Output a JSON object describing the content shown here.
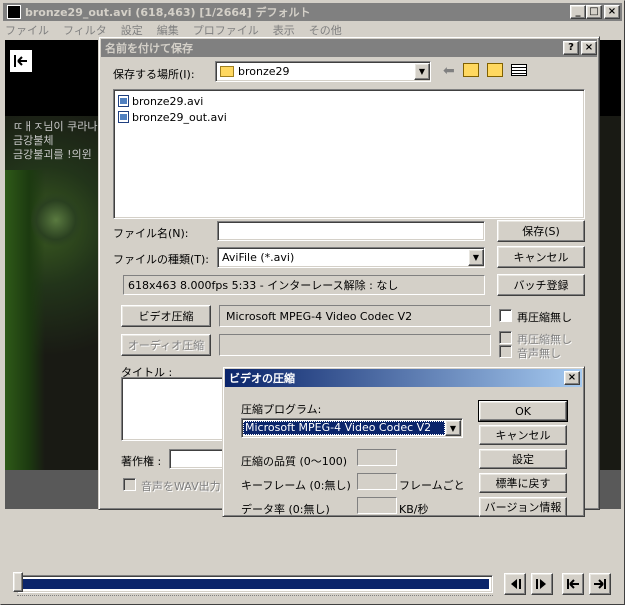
{
  "main": {
    "title": "bronze29_out.avi (618,463) [1/2664] デフォルト",
    "menu": [
      "ファイル",
      "フィルタ",
      "設定",
      "編集",
      "プロファイル",
      "表示",
      "その他"
    ],
    "video_text_lines": [
      "ㄸㅐㅈ님이 쿠라나",
      "금강불체",
      "금강불괴를 !의윈"
    ],
    "back_icon": "arrow-left-bar-icon",
    "transport": [
      "prev-frame-icon",
      "next-frame-icon",
      "first-frame-icon",
      "last-frame-icon"
    ],
    "progress_fraction": 0.0004
  },
  "save_dialog": {
    "title": "名前を付けて保存",
    "save_in_label": "保存する場所(I):",
    "save_in_value": "bronze29",
    "files": [
      "bronze29.avi",
      "bronze29_out.avi"
    ],
    "filename_label": "ファイル名(N):",
    "filename_value": "",
    "filetype_label": "ファイルの種類(T):",
    "filetype_value": "AviFile (*.avi)",
    "save_button": "保存(S)",
    "cancel_button": "キャンセル",
    "batch_button": "バッチ登録",
    "info_text": "618x463  8.000fps  5:33  -  インターレース解除 : なし",
    "video_compress_button": "ビデオ圧縮",
    "video_codec": "Microsoft MPEG-4 Video Codec V2",
    "no_recompress_label": "再圧縮無し",
    "audio_compress_button": "オーディオ圧縮",
    "audio_no_recompress_label": "再圧縮無し",
    "no_audio_label": "音声無し",
    "title_label": "タイトル :",
    "copyright_label": "著作権 :",
    "wav_output_label": "音声をWAV出力"
  },
  "codec_dialog": {
    "title": "ビデオの圧縮",
    "program_label": "圧縮プログラム:",
    "program_value": "Microsoft MPEG-4 Video Codec V2",
    "quality_label": "圧縮の品質 (0〜100)",
    "keyframe_label": "キーフレーム (0:無し)",
    "keyframe_unit": "フレームごと",
    "datarate_label": "データ率 (0:無し)",
    "datarate_unit": "KB/秒",
    "ok_button": "OK",
    "cancel_button": "キャンセル",
    "settings_button": "設定",
    "default_button": "標準に戻す",
    "version_button": "バージョン情報"
  },
  "colors": {
    "active_caption": "#0a246a",
    "inactive_caption": "#808080",
    "progress": "#0a246a"
  }
}
